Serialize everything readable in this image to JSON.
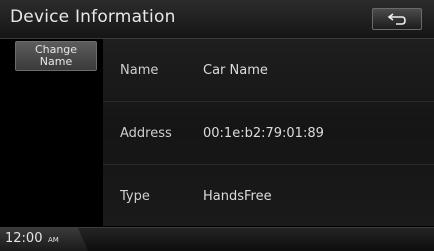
{
  "header": {
    "title": "Device Information",
    "back_icon": "back-arrow-icon"
  },
  "sidebar": {
    "change_name_label": "Change\nName"
  },
  "device": {
    "rows": [
      {
        "label": "Name",
        "value": "Car Name"
      },
      {
        "label": "Address",
        "value": "00:1e:b2:79:01:89"
      },
      {
        "label": "Type",
        "value": "HandsFree"
      }
    ]
  },
  "status": {
    "time": "12:00",
    "ampm": "AM"
  }
}
